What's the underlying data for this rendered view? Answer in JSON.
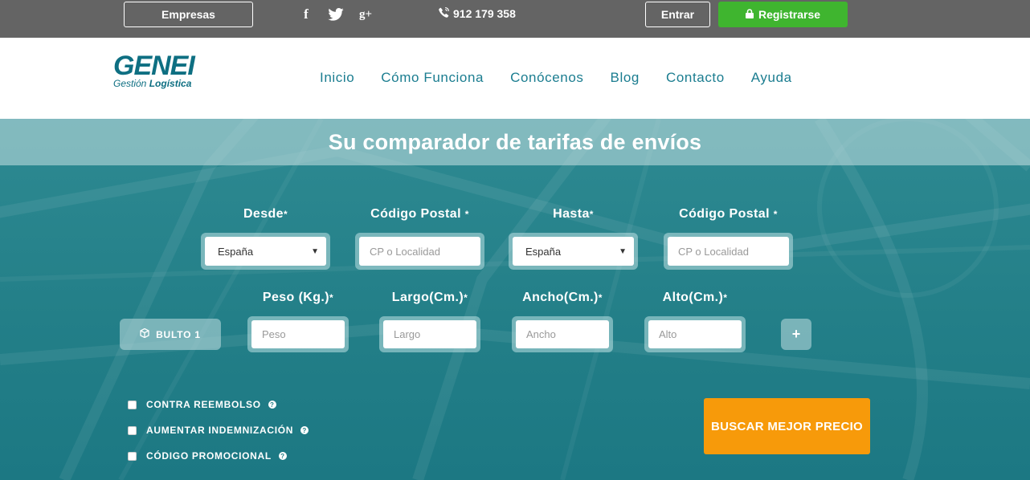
{
  "topbar": {
    "empresas_label": "Empresas",
    "phone": "912 179 358",
    "entrar_label": "Entrar",
    "registrarse_label": "Registrarse",
    "social": {
      "facebook": "f",
      "googleplus": "g+"
    }
  },
  "header": {
    "logo_main": "GENEI",
    "logo_sub_1": "Gestión ",
    "logo_sub_2": "Logística",
    "nav": [
      "Inicio",
      "Cómo Funciona",
      "Conócenos",
      "Blog",
      "Contacto",
      "Ayuda"
    ]
  },
  "hero": {
    "title": "Su comparador de tarifas de envíos",
    "required_mark": "*",
    "from": {
      "label": "Desde",
      "country": "España"
    },
    "from_cp": {
      "label": "Código Postal ",
      "placeholder": "CP o Localidad"
    },
    "to": {
      "label": "Hasta",
      "country": "España"
    },
    "to_cp": {
      "label": "Código Postal ",
      "placeholder": "CP o Localidad"
    },
    "bulto_label": "BULTO 1",
    "weight": {
      "label": "Peso (Kg.)",
      "placeholder": "Peso"
    },
    "length": {
      "label": "Largo(Cm.)",
      "placeholder": "Largo"
    },
    "width": {
      "label": "Ancho(Cm.)",
      "placeholder": "Ancho"
    },
    "height": {
      "label": "Alto(Cm.)",
      "placeholder": "Alto"
    },
    "add_label": "+",
    "options": [
      "CONTRA REEMBOLSO",
      "AUMENTAR INDEMNIZACIÓN",
      "CÓDIGO PROMOCIONAL"
    ],
    "help_glyph": "?",
    "search_label": "BUSCAR MEJOR PRECIO"
  },
  "icons": {
    "facebook": "facebook-icon",
    "twitter": "twitter-icon",
    "googleplus": "google-plus-icon",
    "phone": "phone-icon",
    "lock": "lock-icon",
    "box": "box-icon",
    "help": "help-icon",
    "caret": "caret-down-icon"
  },
  "colors": {
    "topbar": "#646464",
    "register": "#3fb52f",
    "brand": "#0e6f82",
    "hero": "#1f7f86",
    "search": "#f79a0a"
  }
}
